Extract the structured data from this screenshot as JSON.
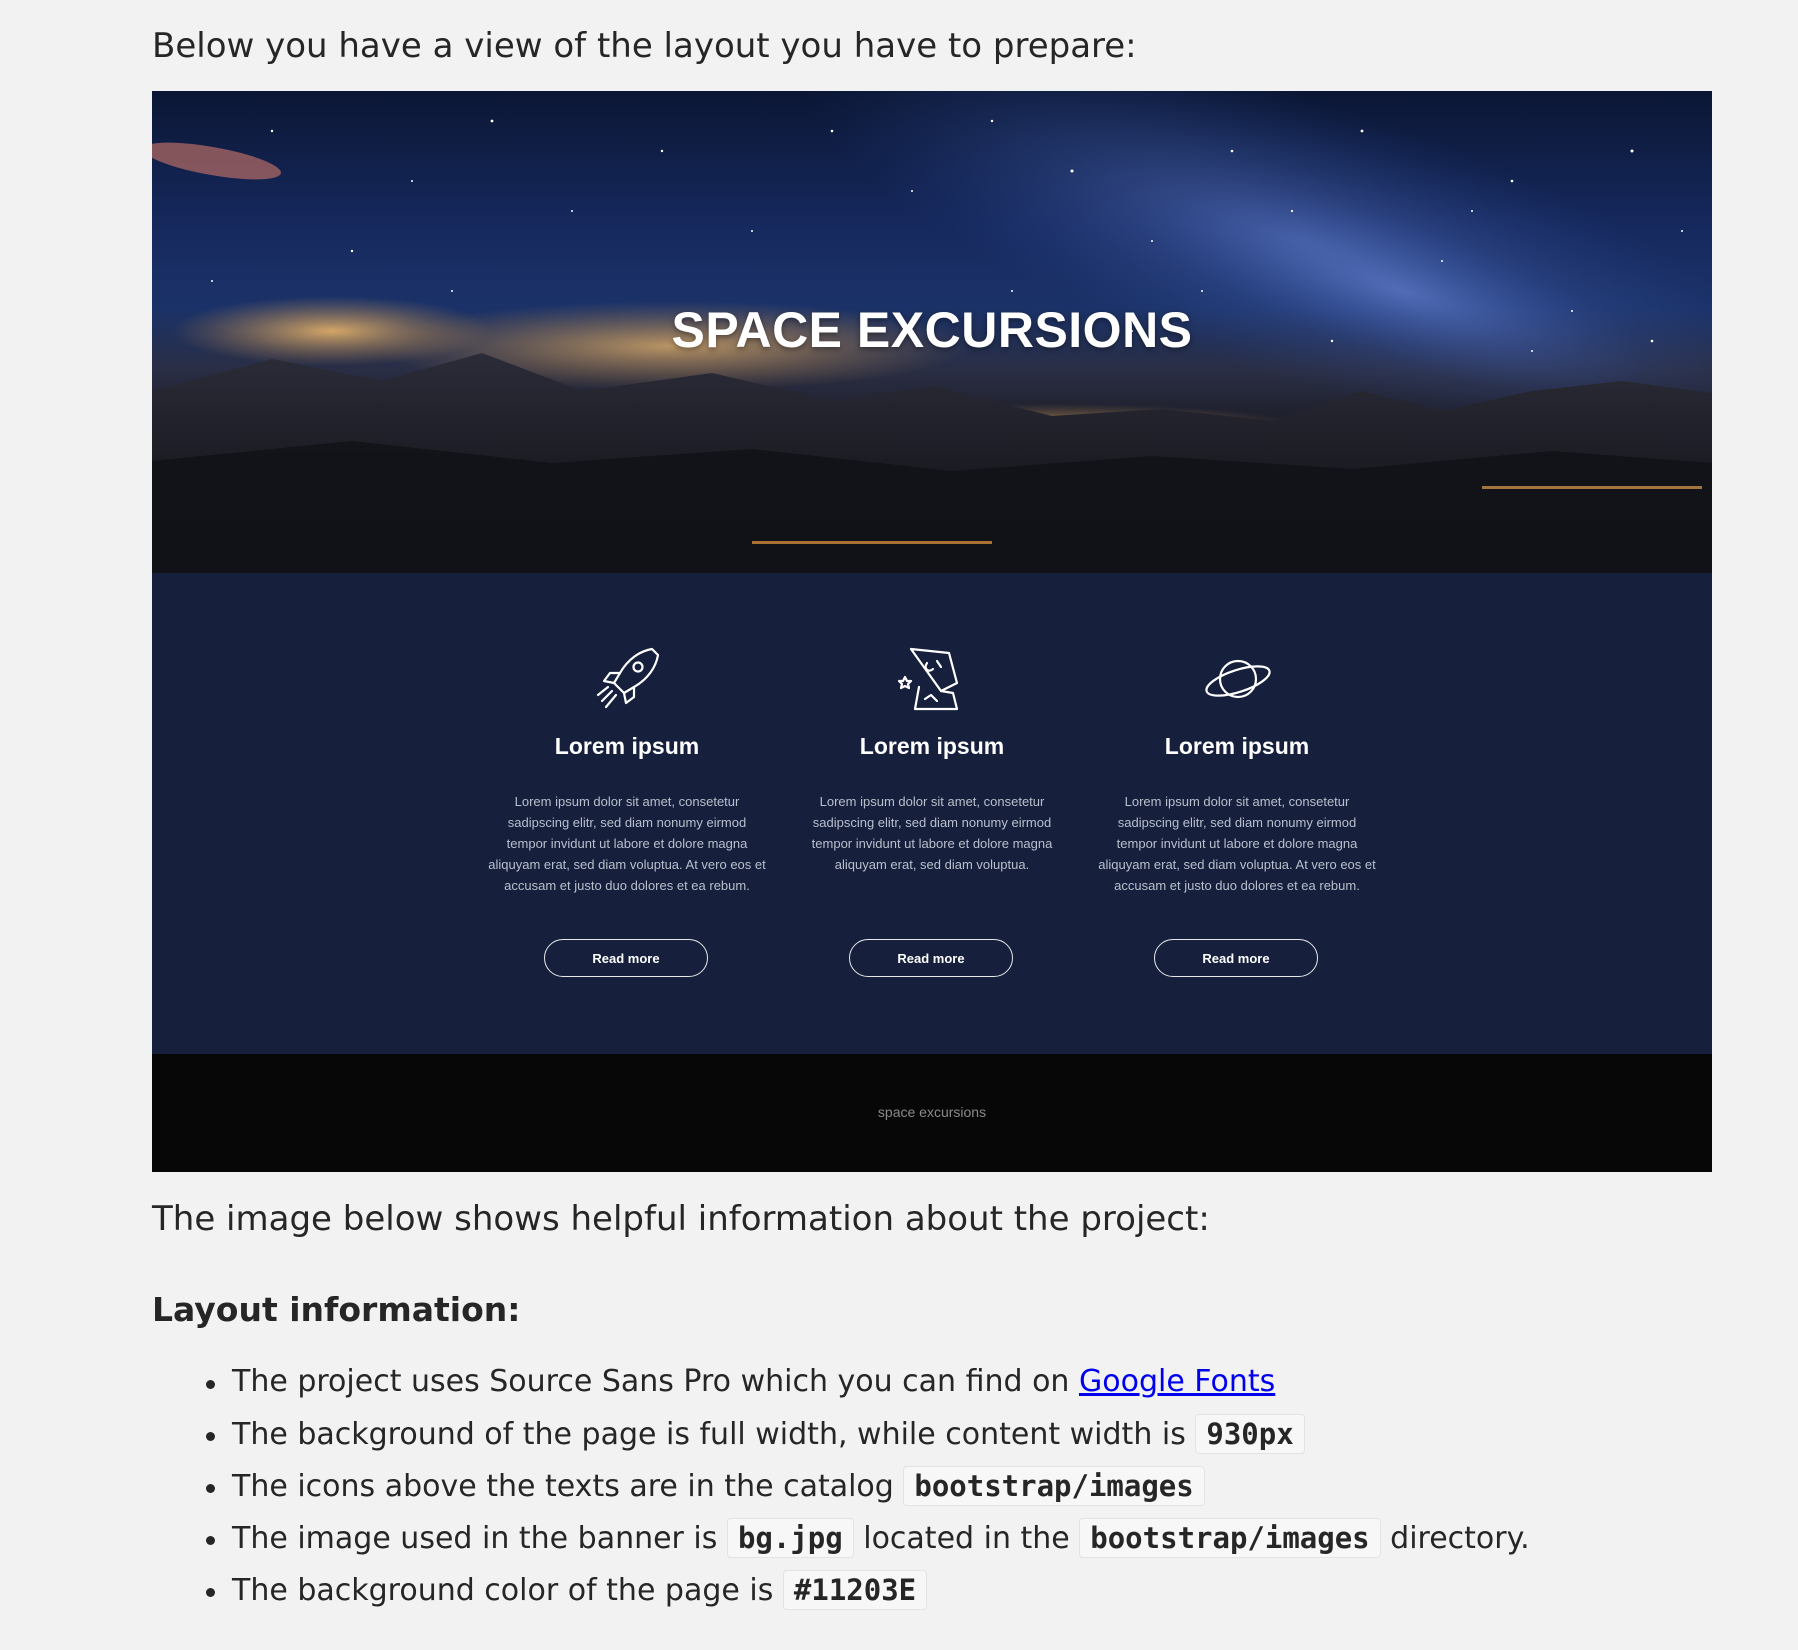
{
  "intro": {
    "text": "Below you have a view of the layout you have to prepare:"
  },
  "mockup": {
    "banner": {
      "title": "SPACE EXCURSIONS"
    },
    "features": [
      {
        "icon": "rocket-icon",
        "title": "Lorem ipsum",
        "text": "Lorem ipsum dolor sit amet, consetetur sadipscing elitr, sed diam nonumy eirmod tempor invidunt ut labore et dolore magna aliquyam erat, sed diam voluptua. At vero eos et accusam et justo duo dolores et ea rebum.",
        "button": "Read more"
      },
      {
        "icon": "crashed-rocket-icon",
        "title": "Lorem ipsum",
        "text": "Lorem ipsum dolor sit amet, consetetur sadipscing elitr, sed diam nonumy eirmod tempor invidunt ut labore et dolore magna aliquyam erat, sed diam voluptua.",
        "button": "Read more"
      },
      {
        "icon": "planet-icon",
        "title": "Lorem ipsum",
        "text": "Lorem ipsum dolor sit amet, consetetur sadipscing elitr, sed diam nonumy eirmod tempor invidunt ut labore et dolore magna aliquyam erat, sed diam voluptua. At vero eos et accusam et justo duo dolores et ea rebum.",
        "button": "Read more"
      }
    ],
    "footer": {
      "text": "space excursions"
    },
    "colors": {
      "features_bg": "#16203d",
      "footer_bg": "#070707"
    }
  },
  "info": {
    "lead": "The image below shows helpful information about the project:",
    "heading": "Layout information:",
    "items": [
      {
        "before": "The project uses Source Sans Pro which you can find on ",
        "link": "Google Fonts"
      },
      {
        "before": "The background of the page is full width, while content width is ",
        "code": "930px"
      },
      {
        "before": "The icons above the texts are in the catalog ",
        "code": "bootstrap/images"
      },
      {
        "before": "The image used in the banner is ",
        "code": "bg.jpg",
        "middle": " located in the ",
        "code2": "bootstrap/images",
        "after": " directory."
      },
      {
        "before": "The background color of the page is ",
        "code": "#11203E"
      }
    ]
  }
}
